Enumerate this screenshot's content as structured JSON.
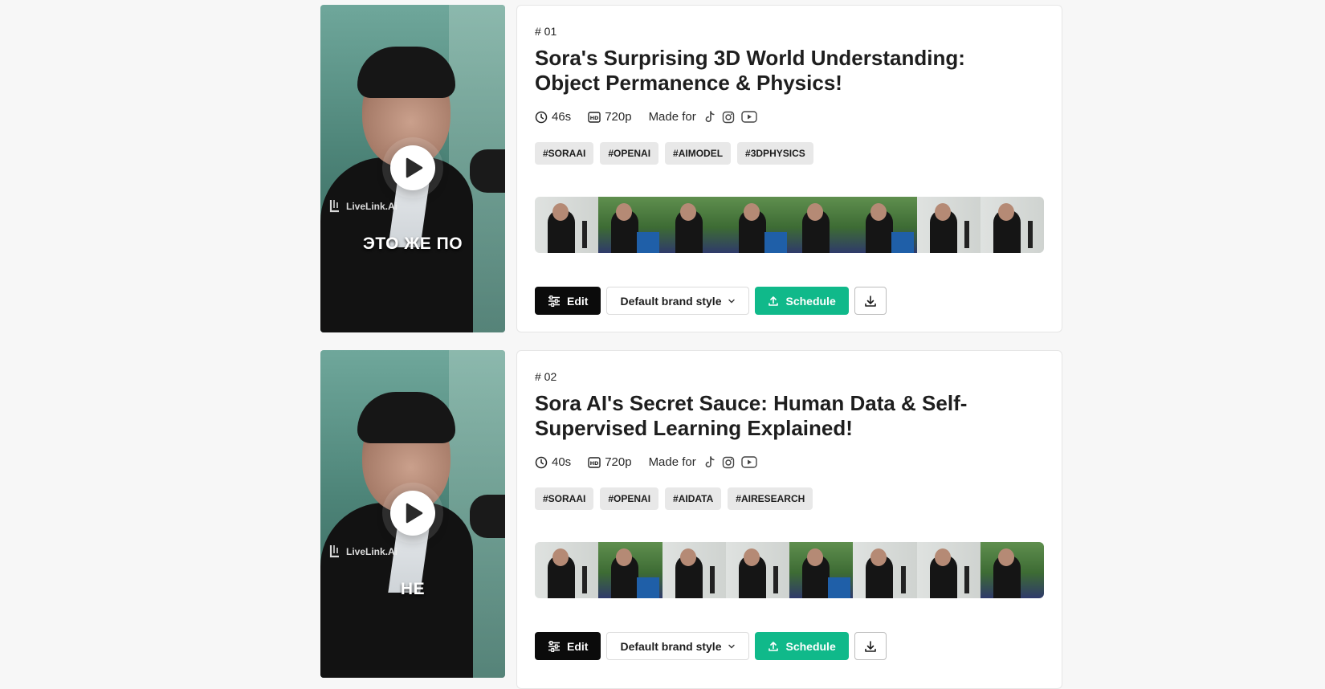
{
  "clips": [
    {
      "number": "# 01",
      "title": "Sora's Surprising 3D World Understanding: Object Permanence & Physics!",
      "duration": "46s",
      "resolution": "720p",
      "made_for_label": "Made for",
      "platforms": [
        "tiktok-icon",
        "instagram-icon",
        "youtube-icon"
      ],
      "tags": [
        "#SORAAI",
        "#OPENAI",
        "#AIMODEL",
        "#3DPHYSICS"
      ],
      "thumbnail": {
        "watermark": "LiveLink.Ai",
        "caption": "ЭТО ЖЕ ПО"
      },
      "actions": {
        "edit_label": "Edit",
        "style_label": "Default brand style",
        "schedule_label": "Schedule"
      }
    },
    {
      "number": "# 02",
      "title": "Sora AI's Secret Sauce: Human Data & Self-Supervised Learning Explained!",
      "duration": "40s",
      "resolution": "720p",
      "made_for_label": "Made for",
      "platforms": [
        "tiktok-icon",
        "instagram-icon",
        "youtube-icon"
      ],
      "tags": [
        "#SORAAI",
        "#OPENAI",
        "#AIDATA",
        "#AIRESEARCH"
      ],
      "thumbnail": {
        "watermark": "LiveLink.Ai",
        "caption": "НЕ"
      },
      "actions": {
        "edit_label": "Edit",
        "style_label": "Default brand style",
        "schedule_label": "Schedule"
      }
    }
  ],
  "colors": {
    "background": "#f7f7f7",
    "edit_button": "#0b0b0b",
    "schedule_button": "#10b98a",
    "tag_background": "#e8e8e8"
  }
}
